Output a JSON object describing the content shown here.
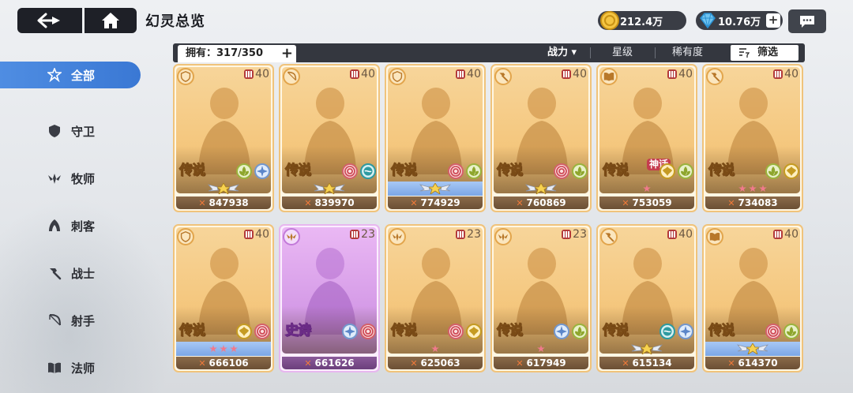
{
  "header": {
    "title": "幻灵总览",
    "gold": "212.4万",
    "gems": "10.76万",
    "gem_plus": "+"
  },
  "sidebar": {
    "items": [
      {
        "label": "全部",
        "icon": "all-icon",
        "active": true
      },
      {
        "label": "守卫",
        "icon": "shield-icon"
      },
      {
        "label": "牧师",
        "icon": "priest-icon"
      },
      {
        "label": "刺客",
        "icon": "assassin-icon"
      },
      {
        "label": "战士",
        "icon": "hammer-icon"
      },
      {
        "label": "射手",
        "icon": "bow-icon"
      },
      {
        "label": "法师",
        "icon": "book-icon"
      }
    ]
  },
  "filterbar": {
    "owned": "拥有：317/350",
    "owned_plus": "+",
    "sort_power": "战力 ▾",
    "sort_stars": "星级",
    "sort_rarity": "稀有度",
    "filter": "筛选"
  },
  "colors": {
    "legend_border": "#f0c37b",
    "epic_border": "#e7b7ef",
    "active_tab": "#3a78d4",
    "topbar_button": "#1e2027"
  },
  "cards": [
    {
      "cls": "shield",
      "level": "40",
      "rarity": "传说",
      "tag": "",
      "elements": [
        "wind",
        "star"
      ],
      "band": "wings",
      "power": "847938",
      "epic": false
    },
    {
      "cls": "bow",
      "level": "40",
      "rarity": "传说",
      "tag": "",
      "elements": [
        "fire",
        "water"
      ],
      "band": "wings",
      "power": "839970",
      "epic": false
    },
    {
      "cls": "shield",
      "level": "40",
      "rarity": "传说",
      "tag": "",
      "elements": [
        "fire",
        "wind"
      ],
      "band": "wings-blue",
      "power": "774929",
      "epic": false
    },
    {
      "cls": "hammer",
      "level": "40",
      "rarity": "传说",
      "tag": "",
      "elements": [
        "fire",
        "wind"
      ],
      "band": "wings",
      "power": "760869",
      "epic": false
    },
    {
      "cls": "book",
      "level": "40",
      "rarity": "传说",
      "tag": "神话",
      "elements": [
        "gold",
        "wind"
      ],
      "band": "star1",
      "power": "753059",
      "epic": false
    },
    {
      "cls": "hammer",
      "level": "40",
      "rarity": "传说",
      "tag": "",
      "elements": [
        "wind",
        "gold"
      ],
      "band": "star3",
      "power": "734083",
      "epic": false
    },
    {
      "cls": "shield",
      "level": "40",
      "rarity": "传说",
      "tag": "",
      "elements": [
        "gold",
        "fire"
      ],
      "band": "star3-blue",
      "power": "666106",
      "epic": false
    },
    {
      "cls": "priest",
      "level": "23",
      "rarity": "史诗",
      "tag": "",
      "elements": [
        "star",
        "fire"
      ],
      "band": "none",
      "power": "661626",
      "epic": true
    },
    {
      "cls": "priest",
      "level": "23",
      "rarity": "传说",
      "tag": "",
      "elements": [
        "fire",
        "gold"
      ],
      "band": "star1",
      "power": "625063",
      "epic": false
    },
    {
      "cls": "priest",
      "level": "23",
      "rarity": "传说",
      "tag": "",
      "elements": [
        "star",
        "wind"
      ],
      "band": "star1",
      "power": "617949",
      "epic": false
    },
    {
      "cls": "hammer",
      "level": "40",
      "rarity": "传说",
      "tag": "",
      "elements": [
        "water",
        "star"
      ],
      "band": "wings",
      "power": "615134",
      "epic": false
    },
    {
      "cls": "book",
      "level": "40",
      "rarity": "传说",
      "tag": "",
      "elements": [
        "fire",
        "wind"
      ],
      "band": "wings-blue",
      "power": "614370",
      "epic": false
    }
  ]
}
